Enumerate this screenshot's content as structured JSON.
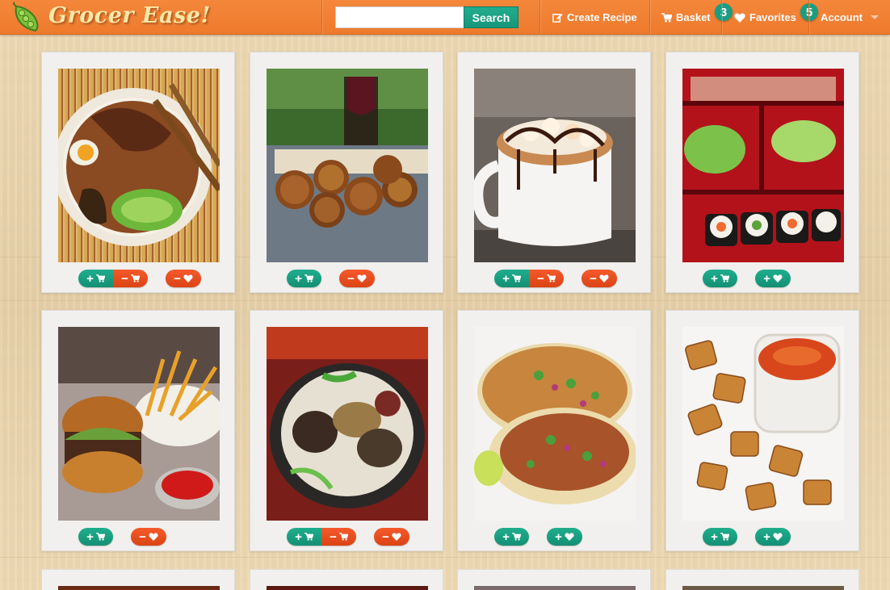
{
  "app": {
    "logo_text": "Grocer Ease!"
  },
  "header": {
    "search": {
      "placeholder": "",
      "value": "",
      "button_label": "Search"
    },
    "nav": {
      "create_recipe": "Create Recipe",
      "basket": "Basket",
      "basket_count": "3",
      "favorites": "Favorites",
      "favorites_count": "5",
      "account": "Account"
    },
    "colors": {
      "bar": "#ef7d31",
      "accent_green": "#179a7e",
      "accent_red": "#ef4f1f"
    }
  },
  "recipes": [
    {
      "dish": "ramen-bowl",
      "in_basket": true,
      "favorited": true
    },
    {
      "dish": "fried-rice-balls",
      "in_basket": false,
      "favorited": true
    },
    {
      "dish": "smores-hot-chocolate",
      "in_basket": true,
      "favorited": true
    },
    {
      "dish": "sushi-bento",
      "in_basket": false,
      "favorited": false
    },
    {
      "dish": "burger-and-fries",
      "in_basket": false,
      "favorited": true
    },
    {
      "dish": "korean-soup",
      "in_basket": true,
      "favorited": true
    },
    {
      "dish": "street-tacos",
      "in_basket": false,
      "favorited": false
    },
    {
      "dish": "toasted-ravioli",
      "in_basket": false,
      "favorited": false
    }
  ],
  "icons": {
    "logo": "pea-pod-icon",
    "create_recipe": "edit-icon",
    "basket": "cart-icon",
    "favorites": "heart-icon",
    "account": "chevron-down-icon",
    "add": "plus-icon",
    "remove": "minus-icon"
  },
  "button_symbols": {
    "plus": "+",
    "minus": "−"
  }
}
